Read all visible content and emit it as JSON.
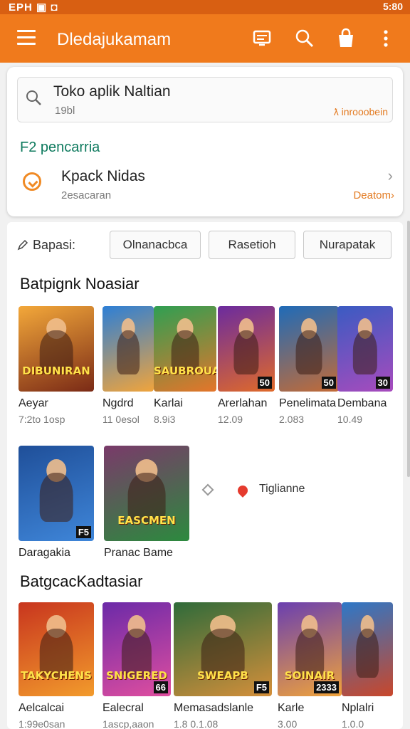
{
  "status_bar": {
    "left": "EPH ▣ ◘",
    "right": "5:80"
  },
  "app_bar": {
    "title": "Dledajukamam"
  },
  "search": {
    "query": "Toko aplik Naltian",
    "subtext": "19bl",
    "advanced_label": "ƛ inrooobein"
  },
  "search_section": {
    "heading": "F2 pencarria"
  },
  "recent_item": {
    "name": "Kpack Nidas",
    "subtitle": "2esacaran",
    "action_label": "Deatom›"
  },
  "filters": {
    "label": "Bapasi:",
    "chips": [
      "Olnanacbca",
      "Rasetioh",
      "Nurapatak"
    ]
  },
  "section1": {
    "title": "Batpignk Noasiar",
    "games": [
      {
        "name": "Aeyar",
        "meta": "7:2to 1osp",
        "wordmark": "DIBUNIRAN",
        "colors": [
          "#f3a83a",
          "#7a2a16"
        ],
        "badge": ""
      },
      {
        "name": "Ngdrd",
        "meta": "11 0esol",
        "wordmark": "",
        "colors": [
          "#2d7fd6",
          "#f0a43c"
        ],
        "badge": ""
      },
      {
        "name": "Karlai",
        "meta": "8.9i3",
        "wordmark": "SAUBROUAM",
        "colors": [
          "#2f9f52",
          "#e5752a"
        ],
        "badge": ""
      },
      {
        "name": "Arerlahan",
        "meta": "12.09",
        "wordmark": "",
        "colors": [
          "#6b2b9e",
          "#e06a2a"
        ],
        "badge": "50"
      },
      {
        "name": "Penelimata",
        "meta": "2.083",
        "wordmark": "",
        "colors": [
          "#1f6bb8",
          "#c46b36"
        ],
        "badge": "50"
      },
      {
        "name": "Dembana",
        "meta": "10.49",
        "wordmark": "",
        "colors": [
          "#3a5bc2",
          "#a84bbd"
        ],
        "badge": "30"
      }
    ]
  },
  "section1_row2": {
    "games": [
      {
        "name": "Daragakia",
        "meta": "",
        "wordmark": "",
        "colors": [
          "#1f4f99",
          "#3f86d9"
        ],
        "badge": "F5"
      },
      {
        "name": "Pranac Bame",
        "meta": "",
        "wordmark": "EASCMEN",
        "colors": [
          "#7a3a6a",
          "#2c8a3e"
        ],
        "badge": ""
      }
    ],
    "link_label": "Tiglianne"
  },
  "section2": {
    "title": "BatgcacKadtasiar",
    "games": [
      {
        "name": "Aelcalcai",
        "meta": "1:99e0san",
        "wordmark": "TAKYCHENS",
        "colors": [
          "#c8351e",
          "#f29b2c"
        ],
        "badge": ""
      },
      {
        "name": "Ealecral",
        "meta": "1ascp,aaon",
        "wordmark": "SNIGERED",
        "colors": [
          "#6b2aa8",
          "#e04e9f"
        ],
        "badge": "66"
      },
      {
        "name": "Memasadslanle",
        "meta": "1.8 0.1.08",
        "wordmark": "SWEAPB",
        "colors": [
          "#2f6b3a",
          "#d48f3a"
        ],
        "badge": "F5"
      },
      {
        "name": "Karle",
        "meta": "3.00",
        "wordmark": "SOINAIR",
        "colors": [
          "#6a3fb0",
          "#f0a33a"
        ],
        "badge": "2333"
      },
      {
        "name": "Nplalri",
        "meta": "1.0.0",
        "wordmark": "",
        "colors": [
          "#2d78c8",
          "#c9472b"
        ],
        "badge": ""
      }
    ]
  }
}
